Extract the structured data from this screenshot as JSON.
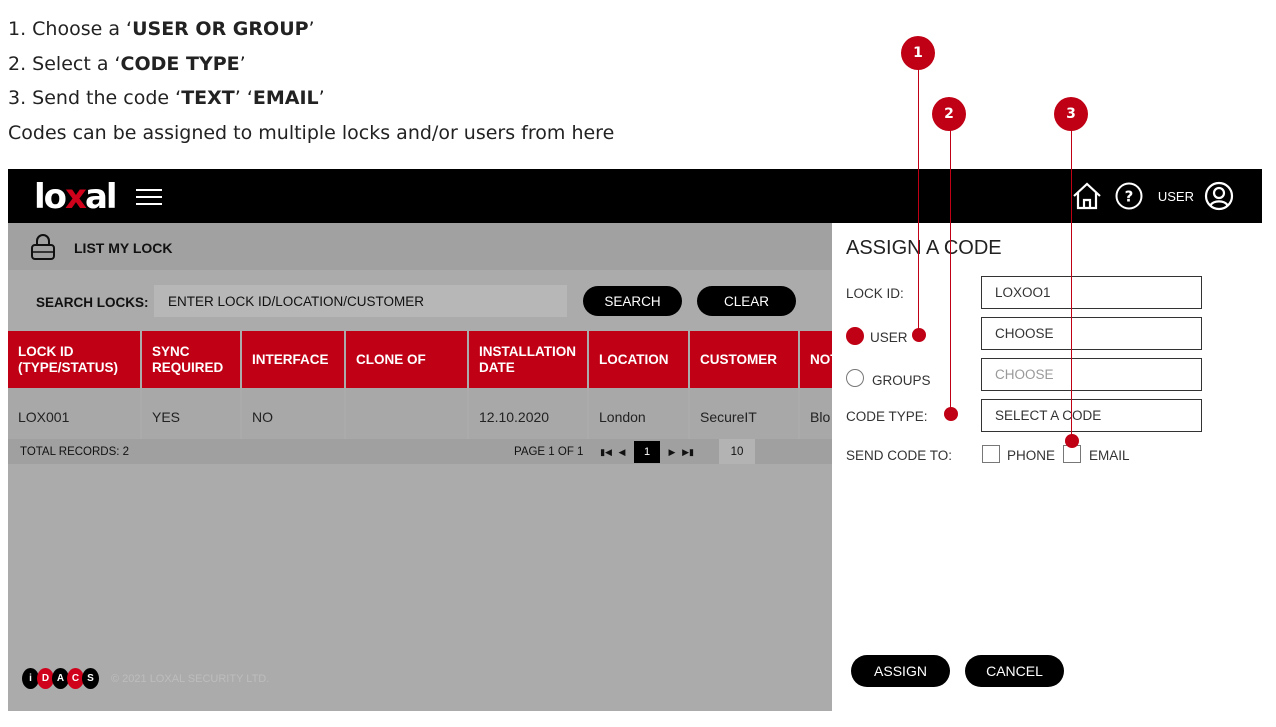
{
  "instructions": {
    "step1": {
      "prefix": "1. Choose a ‘",
      "bold": "USER OR GROUP",
      "suffix": "’"
    },
    "step2": {
      "prefix": "2. Select a ‘",
      "bold": "CODE TYPE",
      "suffix": "’"
    },
    "step3": {
      "prefix": "3. Send the code ‘",
      "bold1": "TEXT",
      "mid": "’ ‘",
      "bold2": "EMAIL",
      "suffix": "’"
    },
    "note": "Codes can be assigned to multiple locks and/or users from here"
  },
  "header": {
    "logo": {
      "part1": "lo",
      "part2": "x",
      "part3": "al"
    },
    "user_label": "USER",
    "icons": [
      "menu-icon",
      "home-icon",
      "help-icon",
      "user-icon"
    ]
  },
  "lock_section": {
    "title": "LIST MY LOCK",
    "icon": "lock-icon"
  },
  "search": {
    "label": "SEARCH LOCKS:",
    "placeholder": "ENTER LOCK ID/LOCATION/CUSTOMER",
    "search_label": "SEARCH",
    "clear_label": "CLEAR"
  },
  "table": {
    "columns": [
      {
        "l1": "LOCK ID",
        "l2": "(TYPE/STATUS)"
      },
      {
        "l1": "SYNC",
        "l2": "REQUIRED"
      },
      {
        "l1": "INTERFACE",
        "l2": ""
      },
      {
        "l1": "CLONE OF",
        "l2": ""
      },
      {
        "l1": "INSTALLATION",
        "l2": "DATE"
      },
      {
        "l1": "LOCATION",
        "l2": ""
      },
      {
        "l1": "CUSTOMER",
        "l2": ""
      },
      {
        "l1": "NOT",
        "l2": ""
      }
    ],
    "rows": [
      [
        "LOX001",
        "YES",
        "NO",
        "",
        "12.10.2020",
        "London",
        "SecureIT",
        "Blo"
      ]
    ],
    "total_records": "TOTAL RECORDS: 2",
    "page_info": "PAGE 1 OF 1",
    "current_page": "1",
    "page_size": "10"
  },
  "footer": {
    "brand": [
      "i",
      "D",
      "A",
      "C",
      "S"
    ],
    "copyright": "© 2021 LOXAL SECURITY LTD."
  },
  "assign_panel": {
    "title": "ASSIGN A CODE",
    "lock_id_label": "LOCK ID:",
    "lock_id_value": "LOXOO1",
    "user_label": "USER",
    "user_value": "CHOOSE",
    "groups_label": "GROUPS",
    "groups_value": "CHOOSE",
    "code_type_label": "CODE TYPE:",
    "code_type_value": "SELECT A CODE",
    "send_label": "SEND CODE TO:",
    "phone_label": "PHONE",
    "email_label": "EMAIL",
    "assign_label": "ASSIGN",
    "cancel_label": "CANCEL"
  },
  "callouts": [
    "1",
    "2",
    "3"
  ],
  "colors": {
    "accent": "#c00014",
    "topbar": "#000000",
    "app_bg": "#ababab"
  }
}
